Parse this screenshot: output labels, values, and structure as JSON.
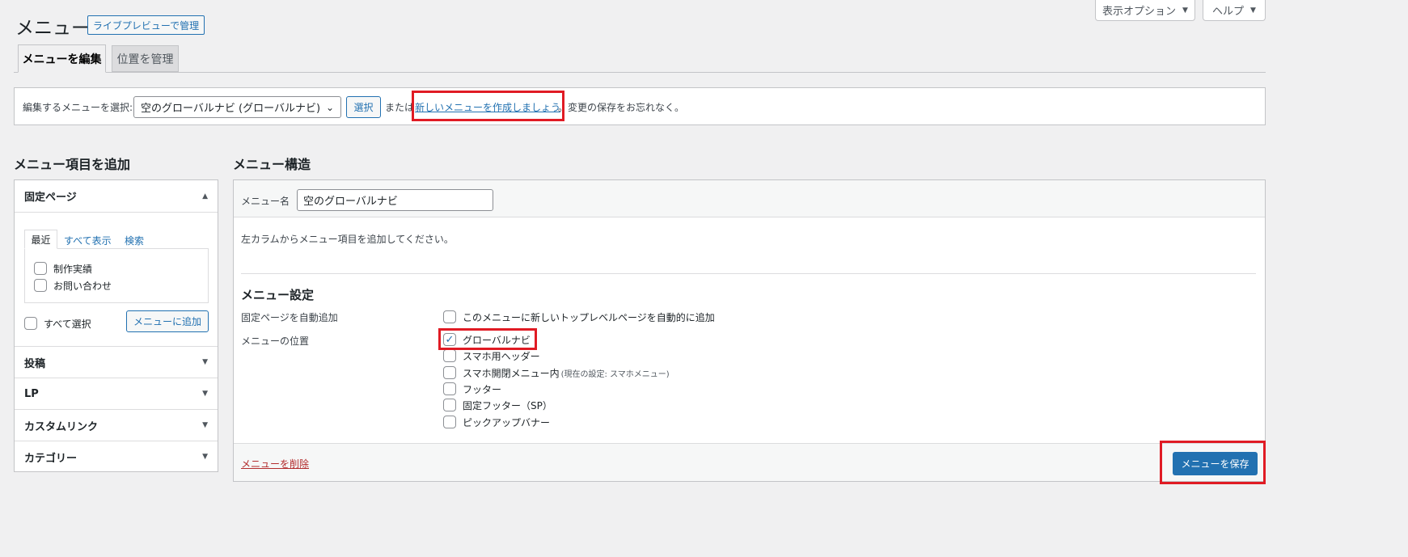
{
  "header": {
    "title": "メニュー",
    "live_preview_button": "ライブプレビューで管理",
    "screen_options": "表示オプション",
    "help": "ヘルプ"
  },
  "tabs": [
    {
      "label": "メニューを編集",
      "active": true
    },
    {
      "label": "位置を管理",
      "active": false
    }
  ],
  "select_bar": {
    "label": "編集するメニューを選択:",
    "selected_menu": "空のグローバルナビ (グローバルナビ)",
    "select_button": "選択",
    "or_text": "または",
    "create_link": "新しいメニューを作成しましょう",
    "after_text": "。変更の保存をお忘れなく。"
  },
  "left": {
    "heading": "メニュー項目を追加",
    "pages_section": {
      "title": "固定ページ",
      "tabs": [
        "最近",
        "すべて表示",
        "検索"
      ],
      "items": [
        "制作実績",
        "お問い合わせ"
      ],
      "select_all": "すべて選択",
      "add_button": "メニューに追加"
    },
    "sections": [
      "投稿",
      "LP",
      "カスタムリンク",
      "カテゴリー"
    ]
  },
  "right": {
    "heading": "メニュー構造",
    "menu_name_label": "メニュー名",
    "menu_name_value": "空のグローバルナビ",
    "instruction": "左カラムからメニュー項目を追加してください。",
    "settings_heading": "メニュー設定",
    "auto_add_label": "固定ページを自動追加",
    "auto_add_option": "このメニューに新しいトップレベルページを自動的に追加",
    "position_label": "メニューの位置",
    "locations": [
      {
        "label": "グローバルナビ",
        "checked": true,
        "note": ""
      },
      {
        "label": "スマホ用ヘッダー",
        "checked": false,
        "note": ""
      },
      {
        "label": "スマホ開閉メニュー内",
        "checked": false,
        "note": "(現在の設定: スマホメニュー)"
      },
      {
        "label": "フッター",
        "checked": false,
        "note": ""
      },
      {
        "label": "固定フッター（SP）",
        "checked": false,
        "note": ""
      },
      {
        "label": "ピックアップバナー",
        "checked": false,
        "note": ""
      }
    ],
    "delete_link": "メニューを削除",
    "save_button": "メニューを保存"
  },
  "colors": {
    "accent": "#2271b1",
    "highlight": "#e01b24",
    "delete": "#b32d2e"
  }
}
